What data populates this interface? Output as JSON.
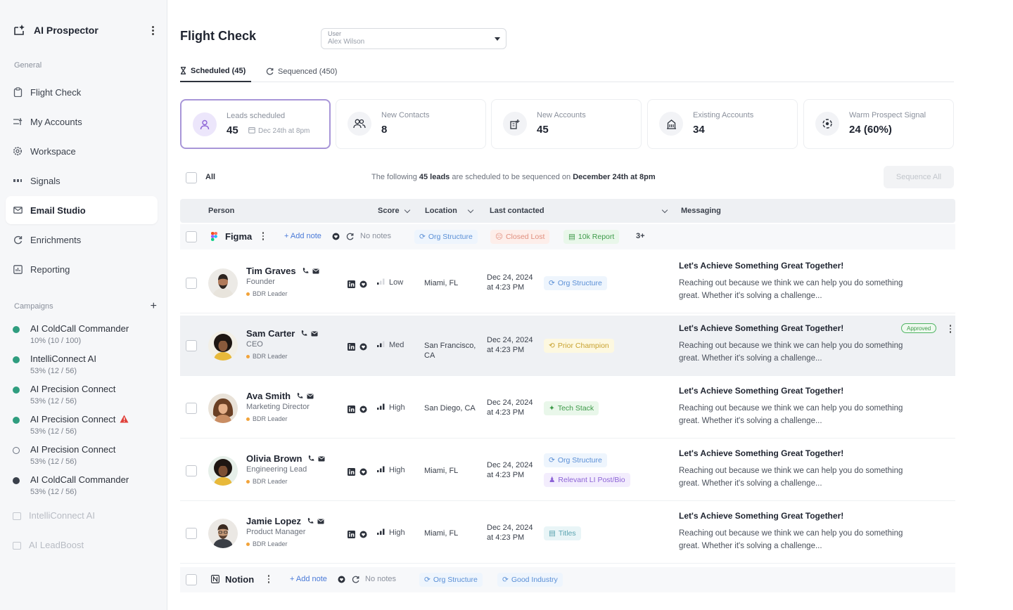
{
  "app": {
    "name": "AI Prospector"
  },
  "sidebar": {
    "general_label": "General",
    "items": [
      {
        "label": "Flight Check",
        "icon": "clipboard-icon"
      },
      {
        "label": "My Accounts",
        "icon": "accounts-icon"
      },
      {
        "label": "Workspace",
        "icon": "gear-icon"
      },
      {
        "label": "Signals",
        "icon": "signal-icon"
      },
      {
        "label": "Email Studio",
        "icon": "mail-icon"
      },
      {
        "label": "Enrichments",
        "icon": "refresh-icon"
      },
      {
        "label": "Reporting",
        "icon": "chart-icon"
      }
    ],
    "campaigns_label": "Campaigns",
    "campaigns": [
      {
        "name": "AI ColdCall Commander",
        "stats": "10% (10 / 100)"
      },
      {
        "name": "IntelliConnect AI",
        "stats": "53% (12 / 56)"
      },
      {
        "name": "AI Precision Connect",
        "stats": "53% (12 / 56)"
      },
      {
        "name": "AI Precision Connect",
        "stats": "53% (12 / 56)"
      },
      {
        "name": "AI Precision Connect",
        "stats": "53% (12 / 56)"
      },
      {
        "name": "AI ColdCall Commander",
        "stats": "53% (12 / 56)"
      },
      {
        "name": "IntelliConnect AI",
        "stats": ""
      },
      {
        "name": "AI LeadBoost",
        "stats": ""
      }
    ]
  },
  "header": {
    "title": "Flight Check",
    "user_select": {
      "label": "User",
      "value": "Alex Wilson"
    }
  },
  "tabs": [
    {
      "label": "Scheduled (45)"
    },
    {
      "label": "Sequenced (450)"
    }
  ],
  "stats": [
    {
      "label": "Leads scheduled",
      "value": "45",
      "sub": "Dec 24th at 8pm"
    },
    {
      "label": "New Contacts",
      "value": "8"
    },
    {
      "label": "New Accounts",
      "value": "45"
    },
    {
      "label": "Existing Accounts",
      "value": "34"
    },
    {
      "label": "Warm Prospect Signal",
      "value": "24 (60%)"
    }
  ],
  "bulk": {
    "all_label": "All",
    "info_prefix": "The following ",
    "info_count": "45 leads",
    "info_middle": " are scheduled to be sequenced on ",
    "info_date": "December 24th at 8pm",
    "sequence_button": "Sequence All"
  },
  "table": {
    "columns": [
      "Person",
      "Score",
      "Location",
      "Last contacted",
      "Messaging"
    ],
    "groups": [
      {
        "name": "Figma",
        "add_note": "+ Add note",
        "notes": "No notes",
        "chips": [
          "Org Structure",
          "Closed Lost",
          "10k Report"
        ],
        "more": "3+"
      },
      {
        "name": "Notion",
        "add_note": "+ Add note",
        "notes": "No notes",
        "chips": [
          "Org Structure",
          "Good Industry"
        ]
      }
    ],
    "rows": [
      {
        "name": "Tim Graves",
        "title": "Founder",
        "role": "BDR Leader",
        "score": "Low",
        "location": "Miami, FL",
        "last_date": "Dec 24, 2024",
        "last_time": "at 4:23 PM",
        "tags": [
          "Org Structure"
        ],
        "msg_title": "Let's Achieve Something Great Together!",
        "msg_body": "Reaching out because we think we can help you do something great. Whether it's solving a challenge..."
      },
      {
        "name": "Sam Carter",
        "title": "CEO",
        "role": "BDR Leader",
        "score": "Med",
        "location": "San Francisco, CA",
        "last_date": "Dec 24, 2024",
        "last_time": "at 4:23 PM",
        "tags": [
          "Prior Champion"
        ],
        "msg_title": "Let's Achieve Something Great Together!",
        "msg_body": "Reaching out because we think we can help you do something great. Whether it's solving a challenge...",
        "status": "Approved"
      },
      {
        "name": "Ava Smith",
        "title": "Marketing Director",
        "role": "BDR Leader",
        "score": "High",
        "location": "San Diego, CA",
        "last_date": "Dec 24, 2024",
        "last_time": "at 4:23 PM",
        "tags": [
          "Tech Stack"
        ],
        "msg_title": "Let's Achieve Something Great Together!",
        "msg_body": "Reaching out because we think we can help you do something great. Whether it's solving a challenge..."
      },
      {
        "name": "Olivia Brown",
        "title": "Engineering Lead",
        "role": "BDR Leader",
        "score": "High",
        "location": "Miami, FL",
        "last_date": "Dec 24, 2024",
        "last_time": "at 4:23 PM",
        "tags": [
          "Org Structure",
          "Relevant LI Post/Bio"
        ],
        "msg_title": "Let's Achieve Something Great Together!",
        "msg_body": "Reaching out because we think we can help you do something great. Whether it's solving a challenge..."
      },
      {
        "name": "Jamie Lopez",
        "title": "Product Manager",
        "role": "BDR Leader",
        "score": "High",
        "location": "Miami, FL",
        "last_date": "Dec 24, 2024",
        "last_time": "at 4:23 PM",
        "tags": [
          "Titles"
        ],
        "msg_title": "Let's Achieve Something Great Together!",
        "msg_body": "Reaching out because we think we can help you do something great. Whether it's solving a challenge..."
      }
    ]
  },
  "colors": {
    "accent": "#a896d8",
    "campaign_active": "#2f9d7f",
    "approved": "#4fb463",
    "warning": "#e0413a"
  }
}
